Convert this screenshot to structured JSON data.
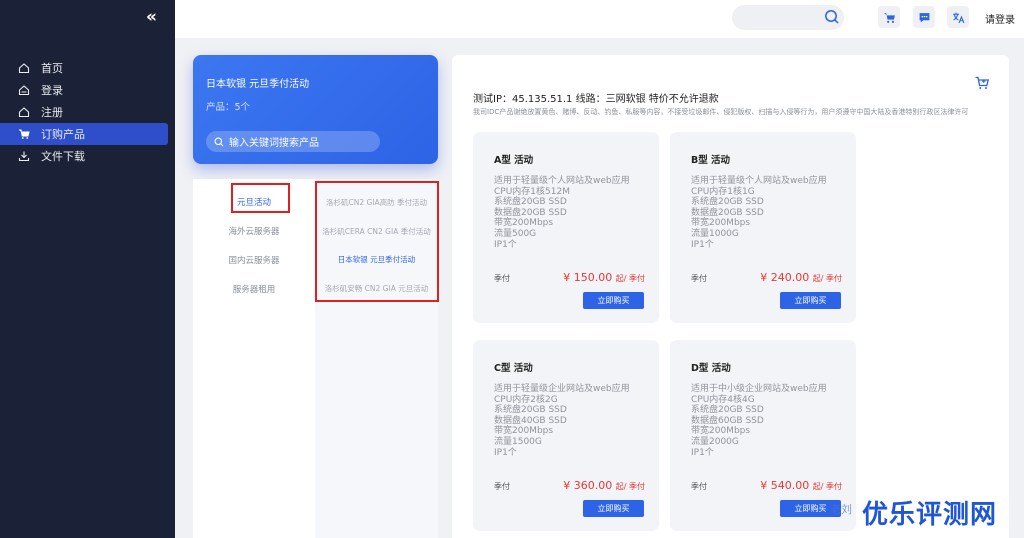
{
  "sidebar": {
    "collapse_glyph": "«",
    "items": [
      {
        "label": "首页",
        "icon": "home-icon"
      },
      {
        "label": "登录",
        "icon": "login-icon"
      },
      {
        "label": "注册",
        "icon": "register-icon"
      },
      {
        "label": "订购产品",
        "icon": "cart-icon",
        "active": true
      },
      {
        "label": "文件下载",
        "icon": "download-icon"
      }
    ]
  },
  "topbar": {
    "search_placeholder": "",
    "login_label": "请登录"
  },
  "group": {
    "title": "日本软银 元旦季付活动",
    "count": "产品：5个",
    "search_placeholder": "输入关键词搜索产品"
  },
  "categories": [
    {
      "label": "元旦活动",
      "active": true
    },
    {
      "label": "海外云服务器"
    },
    {
      "label": "国内云服务器"
    },
    {
      "label": "服务器租用"
    }
  ],
  "subgroups": [
    {
      "label": "洛杉矶CN2 GIA高防 季付活动"
    },
    {
      "label": "洛杉矶CERA CN2 GIA 季付活动"
    },
    {
      "label": "日本软银 元旦季付活动",
      "active": true
    },
    {
      "label": "洛杉矶安畅 CN2 GIA 元旦活动"
    }
  ],
  "main": {
    "title": "测试IP：45.135.51.1 线路：三网软银 特价不允许退款",
    "desc": "我司IDC产品谢绝放置黄色、赌博、反动、钓鱼、私服等内容，不接受垃圾邮件、侵犯版权、扫描与入侵等行为，用户须遵守中国大陆及香港特别行政区法律许可"
  },
  "products": [
    {
      "name": "A型 活动",
      "specs": [
        "适用于轻量级个人网站及web应用",
        "CPU内存1核512M",
        "系统盘20GB SSD",
        "数据盘20GB SSD",
        "带宽200Mbps",
        "流量500G",
        "IP1个"
      ],
      "cycle": "季付",
      "price": "¥ 150.00",
      "price_unit": "起/ 季付",
      "buy_label": "立即购买"
    },
    {
      "name": "B型 活动",
      "specs": [
        "适用于轻量级个人网站及web应用",
        "CPU内存1核1G",
        "系统盘20GB SSD",
        "数据盘20GB SSD",
        "带宽200Mbps",
        "流量1000G",
        "IP1个"
      ],
      "cycle": "季付",
      "price": "¥ 240.00",
      "price_unit": "起/ 季付",
      "buy_label": "立即购买"
    },
    {
      "name": "C型 活动",
      "specs": [
        "适用于轻量级企业网站及web应用",
        "CPU内存2核2G",
        "系统盘20GB SSD",
        "数据盘40GB SSD",
        "带宽200Mbps",
        "流量1500G",
        "IP1个"
      ],
      "cycle": "季付",
      "price": "¥ 360.00",
      "price_unit": "起/ 季付",
      "buy_label": "立即购买"
    },
    {
      "name": "D型 活动",
      "specs": [
        "适用于中小级企业网站及web应用",
        "CPU内存4核4G",
        "系统盘20GB SSD",
        "数据盘60GB SSD",
        "带宽200Mbps",
        "流量2000G",
        "IP1个"
      ],
      "cycle": "季付",
      "price": "¥ 540.00",
      "price_unit": "起/ 季付",
      "buy_label": "立即购买"
    }
  ],
  "watermark": {
    "faint": "老刘",
    "brand": "优乐评测网"
  },
  "colors": {
    "accent": "#2d63e6",
    "sidebar_bg": "#1b2237",
    "price": "#e53935",
    "annotation": "#e02020"
  }
}
